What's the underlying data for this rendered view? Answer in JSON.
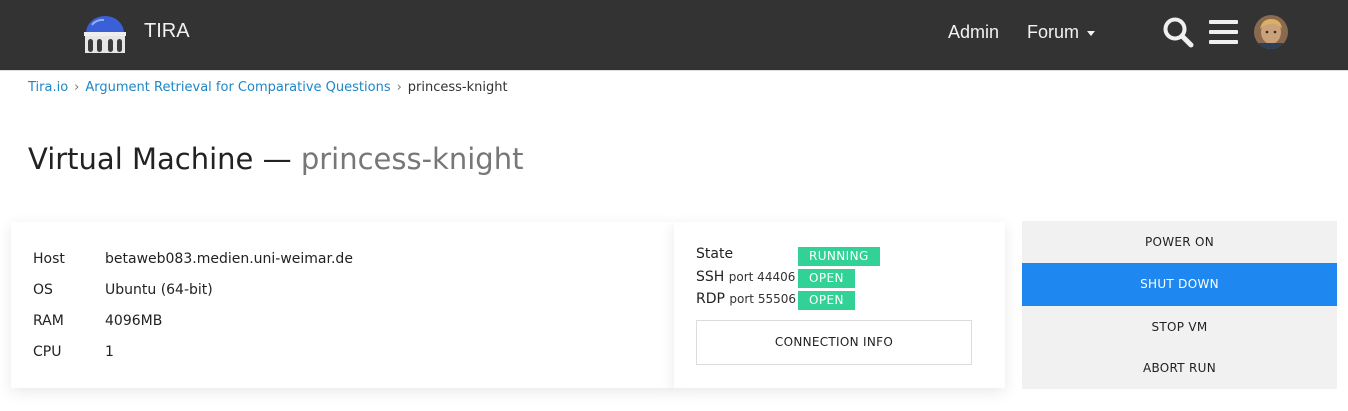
{
  "header": {
    "brand": "TIRA",
    "nav": {
      "admin": "Admin",
      "forum": "Forum"
    },
    "colors": {
      "bar": "#333333"
    },
    "icons": [
      "logo-icon",
      "search-icon",
      "menu-icon",
      "avatar"
    ]
  },
  "breadcrumb": {
    "items": [
      "Tira.io",
      "Argument Retrieval for Comparative Questions"
    ],
    "current": "princess-knight",
    "separator": "›"
  },
  "page": {
    "title_prefix": "Virtual Machine —",
    "title_name": "princess-knight"
  },
  "vm": {
    "specs": [
      {
        "key": "Host",
        "value": "betaweb083.medien.uni-weimar.de"
      },
      {
        "key": "OS",
        "value": "Ubuntu (64-bit)"
      },
      {
        "key": "RAM",
        "value": "4096MB"
      },
      {
        "key": "CPU",
        "value": "1"
      }
    ],
    "status": {
      "state_label": "State",
      "state_value": "RUNNING",
      "ssh_label": "SSH",
      "ssh_port": "port 44406",
      "ssh_value": "OPEN",
      "rdp_label": "RDP",
      "rdp_port": "port 55506",
      "rdp_value": "OPEN",
      "badge_color": "#32d296"
    },
    "connection_button": "CONNECTION INFO"
  },
  "actions": {
    "power_on": "POWER ON",
    "shut_down": "SHUT DOWN",
    "stop_vm": "STOP VM",
    "abort_run": "ABORT RUN",
    "primary_color": "#1e87f0"
  }
}
